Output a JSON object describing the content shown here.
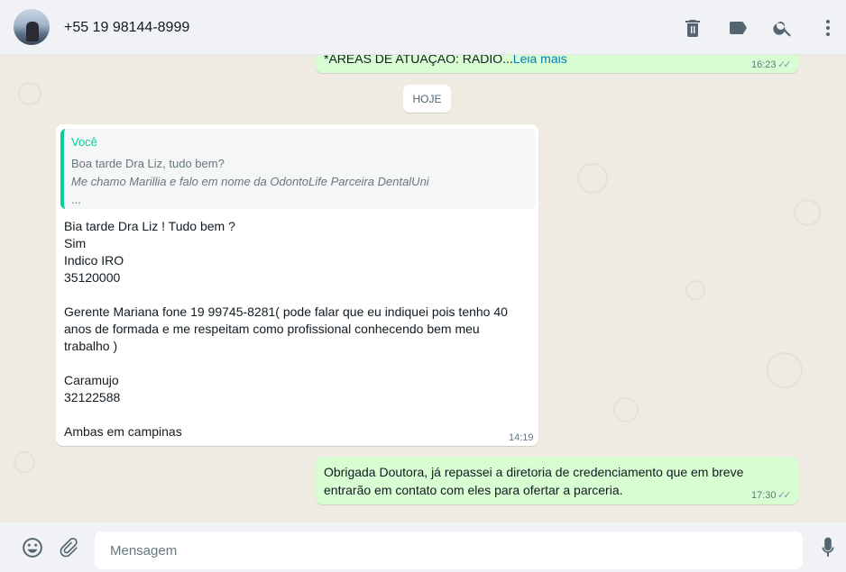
{
  "header": {
    "contact": "+55 19 98144-8999"
  },
  "chat": {
    "prev_message": {
      "text": "*ÁREAS DE ATUAÇÃO: RADIO...",
      "read_more": "Leia mais",
      "time": "16:23"
    },
    "day_divider": "HOJE",
    "incoming": {
      "quote_author": "Você",
      "quote_lines": [
        "Boa tarde Dra Liz, tudo bem?",
        "Me chamo Marillia e falo em nome da OdontoLife Parceira DentalUni",
        "..."
      ],
      "lines": [
        "Bia tarde Dra Liz ! Tudo bem ?",
        "Sim",
        "Indico IRO",
        "35120000",
        "",
        "Gerente Mariana fone 19 99745-8281( pode falar que eu indiquei pois tenho 40",
        "anos de formada e me respeitam como profissional conhecendo bem meu",
        "trabalho )",
        "",
        "Caramujo",
        "32122588",
        "",
        "Ambas em campinas"
      ],
      "time": "14:19"
    },
    "outgoing": {
      "lines": [
        "Obrigada Doutora, já repassei a diretoria de credenciamento que em breve",
        "entrarão em contato com eles para ofertar a parceria."
      ],
      "time": "17:30",
      "status_icon": "double-check-icon"
    }
  },
  "footer": {
    "placeholder": "Mensagem"
  },
  "icons": {
    "header": [
      "delete-icon",
      "label-icon",
      "search-icon",
      "menu-icon"
    ],
    "footer": [
      "emoji-icon",
      "attach-icon",
      "microphone-icon"
    ]
  },
  "colors": {
    "outgoing_bubble": "#d9fdd3",
    "incoming_bubble": "#ffffff",
    "quote_accent": "#06cf9c",
    "chat_background": "#efeae2",
    "header_background": "#f0f2f5"
  }
}
